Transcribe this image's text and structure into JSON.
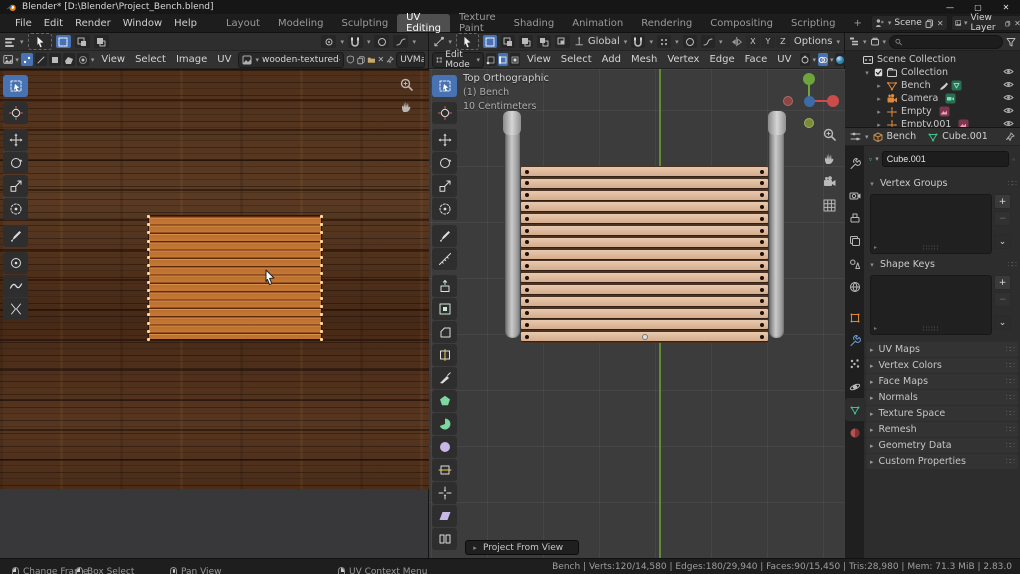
{
  "window": {
    "title": "Blender* [D:\\Blender\\Project_Bench.blend]",
    "controls": {
      "minimize": "—",
      "maximize": "▢",
      "close": "✕"
    }
  },
  "topbar": {
    "menus": [
      "File",
      "Edit",
      "Render",
      "Window",
      "Help"
    ],
    "tabs": [
      "Layout",
      "Modeling",
      "Sculpting",
      "UV Editing",
      "Texture Paint",
      "Shading",
      "Animation",
      "Rendering",
      "Compositing",
      "Scripting",
      "+"
    ],
    "active_tab": "UV Editing",
    "scene_label": "Scene",
    "view_layer_label": "View Layer"
  },
  "uv_editor": {
    "menus": [
      "View",
      "Select",
      "Image",
      "UV"
    ],
    "image_name": "wooden-textured-b...",
    "uvmap_label": "UVMa",
    "toolbar": [
      {
        "name": "select-box",
        "icon": "select-box",
        "active": true
      },
      {
        "name": "cursor",
        "icon": "cursor",
        "gap": true
      },
      {
        "name": "move",
        "icon": "move",
        "gap": true
      },
      {
        "name": "rotate",
        "icon": "rotate"
      },
      {
        "name": "scale",
        "icon": "scale"
      },
      {
        "name": "transform",
        "icon": "transform"
      },
      {
        "name": "annotate",
        "icon": "annotate",
        "gap": true
      },
      {
        "name": "grab",
        "icon": "grab",
        "gap": true
      },
      {
        "name": "relax",
        "icon": "relax"
      },
      {
        "name": "pinch",
        "icon": "pinch"
      }
    ],
    "island": {
      "plank_count": 15,
      "edge_vertex_count": 16
    }
  },
  "viewport": {
    "mode_label": "Edit Mode",
    "menus": [
      "View",
      "Select",
      "Add",
      "Mesh",
      "Vertex",
      "Edge",
      "Face",
      "UV"
    ],
    "orientation_label": "Global",
    "options_label": "Options",
    "mirror_axes": [
      "X",
      "Y",
      "Z"
    ],
    "overlay": [
      "Top Orthographic",
      "(1) Bench",
      "10 Centimeters"
    ],
    "operator_panel_label": "Project From View",
    "toolbar": [
      {
        "name": "select-box",
        "icon": "select-box",
        "active": true
      },
      {
        "name": "cursor",
        "icon": "cursor",
        "gap": true
      },
      {
        "name": "move",
        "icon": "move",
        "gap": true
      },
      {
        "name": "rotate",
        "icon": "rotate"
      },
      {
        "name": "scale",
        "icon": "scale"
      },
      {
        "name": "transform",
        "icon": "transform"
      },
      {
        "name": "annotate",
        "icon": "annotate",
        "gap": true
      },
      {
        "name": "measure",
        "icon": "measure"
      },
      {
        "name": "extrude-region",
        "icon": "extrude",
        "gap": true
      },
      {
        "name": "inset-faces",
        "icon": "inset"
      },
      {
        "name": "bevel",
        "icon": "bevel"
      },
      {
        "name": "loop-cut",
        "icon": "loopcut"
      },
      {
        "name": "knife",
        "icon": "knife"
      },
      {
        "name": "poly-build",
        "icon": "polybuild"
      },
      {
        "name": "spin",
        "icon": "spin"
      },
      {
        "name": "smooth",
        "icon": "smooth"
      },
      {
        "name": "edge-slide",
        "icon": "edgeslide"
      },
      {
        "name": "shrink-fatten",
        "icon": "shrink"
      },
      {
        "name": "shear",
        "icon": "shear"
      },
      {
        "name": "rip-region",
        "icon": "rip"
      }
    ],
    "bench": {
      "slat_count": 15
    }
  },
  "outliner": {
    "search_placeholder": "",
    "items": [
      {
        "label": "Scene Collection",
        "icon": "scene-collection",
        "level": 0,
        "disc": "",
        "extras": [],
        "eye": false
      },
      {
        "label": "Collection",
        "icon": "collection",
        "level": 1,
        "disc": "▾",
        "extras": [],
        "eye": true,
        "checkbox": true
      },
      {
        "label": "Bench",
        "icon": "mesh-object",
        "level": 2,
        "disc": "▸",
        "extras": [
          "brush",
          "mesh-data"
        ],
        "eye": true
      },
      {
        "label": "Camera",
        "icon": "camera-object",
        "level": 2,
        "disc": "▸",
        "extras": [
          "camera-data"
        ],
        "eye": true
      },
      {
        "label": "Empty",
        "icon": "empty-object",
        "level": 2,
        "disc": "▸",
        "extras": [
          "image-data"
        ],
        "eye": true
      },
      {
        "label": "Empty.001",
        "icon": "empty-object",
        "level": 2,
        "disc": "▸",
        "extras": [
          "image-data"
        ],
        "eye": true
      }
    ]
  },
  "properties": {
    "breadcrumb": {
      "object": "Bench",
      "data": "Cube.001"
    },
    "name_field": "Cube.001",
    "tabs": [
      {
        "name": "tool"
      },
      {
        "name": "render",
        "gap": true
      },
      {
        "name": "output"
      },
      {
        "name": "view-layer"
      },
      {
        "name": "scene"
      },
      {
        "name": "world"
      },
      {
        "name": "object",
        "gap": true
      },
      {
        "name": "modifiers"
      },
      {
        "name": "particles"
      },
      {
        "name": "physics"
      },
      {
        "name": "object-data",
        "active": true
      },
      {
        "name": "material"
      }
    ],
    "panels_open": [
      "Vertex Groups",
      "Shape Keys"
    ],
    "list_buttons": {
      "add": "+",
      "remove": "−",
      "more": "⌄"
    },
    "panels_collapsed": [
      "UV Maps",
      "Vertex Colors",
      "Face Maps",
      "Normals",
      "Texture Space",
      "Remesh",
      "Geometry Data",
      "Custom Properties"
    ]
  },
  "statusbar": {
    "hints": [
      {
        "button": "left",
        "label": "Change Frame"
      },
      {
        "button": "left",
        "label": "Box Select"
      },
      {
        "button": "middle",
        "label": "Pan View"
      },
      {
        "button": "right",
        "label": "UV Context Menu"
      }
    ],
    "stats": "Bench | Verts:120/14,580 | Edges:180/29,940 | Faces:90/15,450 | Tris:28,980 | Mem: 71.3 MiB | 2.83.0"
  },
  "colors": {
    "accent_blue": "#4772b3",
    "selection_orange": "#e28a30",
    "axis_green": "#6ca832",
    "mesh_data_green": "#3fc28f",
    "object_orange": "#e0883a"
  }
}
